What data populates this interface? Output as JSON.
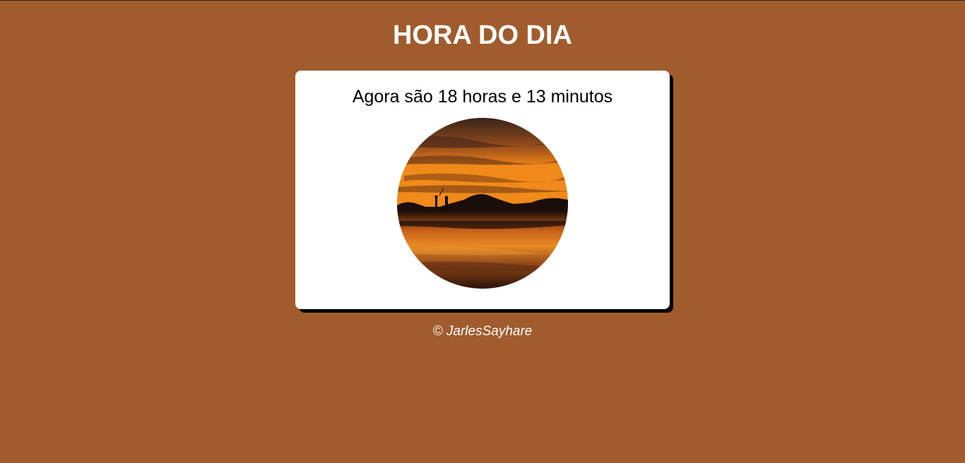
{
  "page": {
    "title": "HORA DO DIA",
    "background_color": "#a05c2c"
  },
  "card": {
    "message": "Agora são 18 horas e 13 minutos",
    "image": {
      "icon": "sunset-photo",
      "shape": "circle"
    }
  },
  "footer": {
    "copyright": "© JarlesSayhare"
  }
}
